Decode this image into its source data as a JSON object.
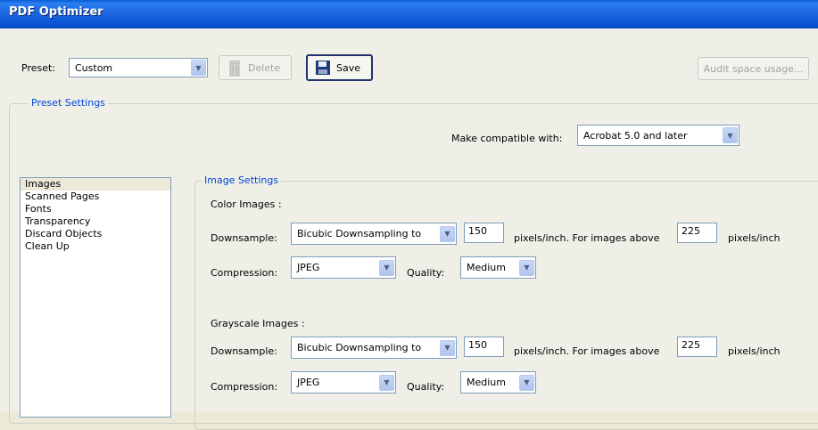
{
  "window": {
    "title": "PDF Optimizer"
  },
  "toolbar": {
    "preset_label": "Preset:",
    "preset_value": "Custom",
    "delete_label": "Delete",
    "save_label": "Save",
    "audit_label": "Audit space usage..."
  },
  "preset_settings": {
    "legend": "Preset Settings",
    "compat_label": "Make compatible with:",
    "compat_value": "Acrobat 5.0 and later"
  },
  "panels": [
    {
      "label": "Images",
      "selected": true
    },
    {
      "label": "Scanned Pages"
    },
    {
      "label": "Fonts"
    },
    {
      "label": "Transparency"
    },
    {
      "label": "Discard Objects"
    },
    {
      "label": "Clean Up"
    }
  ],
  "image_settings": {
    "legend": "Image Settings",
    "color": {
      "heading": "Color Images :",
      "downsample_label": "Downsample:",
      "downsample_value": "Bicubic Downsampling to",
      "ppi": "150",
      "above_label": "pixels/inch. For images above",
      "above_ppi": "225",
      "unit_label": "pixels/inch",
      "compression_label": "Compression:",
      "compression_value": "JPEG",
      "quality_label": "Quality:",
      "quality_value": "Medium"
    },
    "grayscale": {
      "heading": "Grayscale Images :",
      "downsample_label": "Downsample:",
      "downsample_value": "Bicubic Downsampling to",
      "ppi": "150",
      "above_label": "pixels/inch. For images above",
      "above_ppi": "225",
      "unit_label": "pixels/inch",
      "compression_label": "Compression:",
      "compression_value": "JPEG",
      "quality_label": "Quality:",
      "quality_value": "Medium"
    }
  }
}
